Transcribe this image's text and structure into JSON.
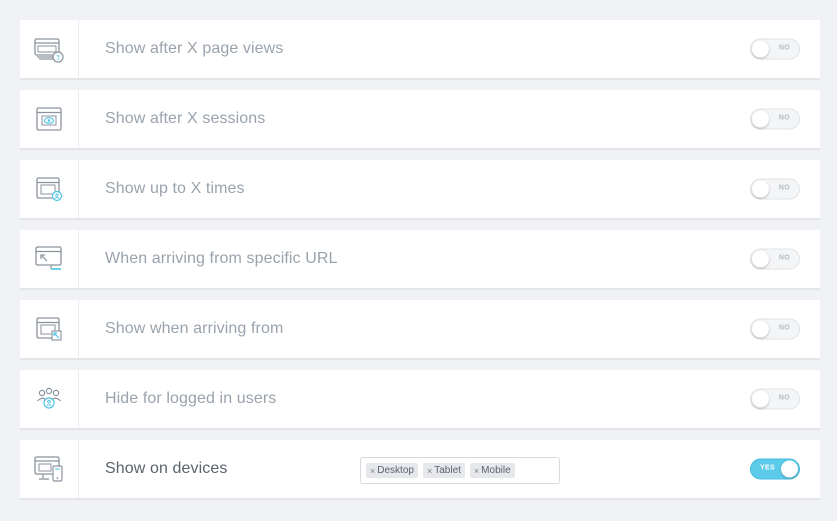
{
  "colors": {
    "background": "#f1f2f5",
    "row_bg": "#ffffff",
    "label_muted": "#9aa3ad",
    "label_active": "#5b636d",
    "icon_stroke": "#8b939c",
    "icon_accent": "#4fc3e8",
    "toggle_on": "#5ccbea"
  },
  "rows": [
    {
      "label": "Show after X page views",
      "icon": "page-views-icon",
      "toggle": "NO",
      "enabled": false
    },
    {
      "label": "Show after X sessions",
      "icon": "sessions-icon",
      "toggle": "NO",
      "enabled": false
    },
    {
      "label": "Show up to X times",
      "icon": "times-icon",
      "toggle": "NO",
      "enabled": false
    },
    {
      "label": "When arriving from specific URL",
      "icon": "url-icon",
      "toggle": "NO",
      "enabled": false
    },
    {
      "label": "Show when arriving from",
      "icon": "arriving-from-icon",
      "toggle": "NO",
      "enabled": false
    },
    {
      "label": "Hide for logged in users",
      "icon": "users-icon",
      "toggle": "NO",
      "enabled": false
    },
    {
      "label": "Show on devices",
      "icon": "devices-icon",
      "toggle": "YES",
      "enabled": true,
      "tags": [
        {
          "remove": "×",
          "label": "Desktop"
        },
        {
          "remove": "×",
          "label": "Tablet"
        },
        {
          "remove": "×",
          "label": "Mobile"
        }
      ]
    }
  ]
}
